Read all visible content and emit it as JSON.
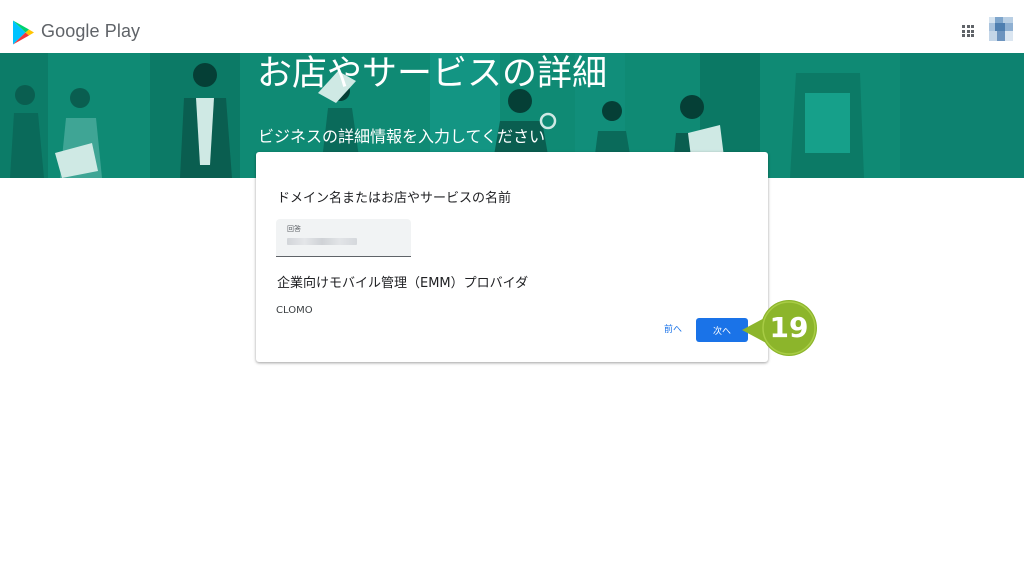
{
  "header": {
    "brand": "Google Play",
    "apps_icon": "apps-grid-icon",
    "avatar": "user-avatar"
  },
  "banner": {
    "title": "お店やサービスの詳細",
    "subtitle": "ビジネスの詳細情報を入力してください",
    "color": "#0f8a74"
  },
  "form": {
    "question1": "ドメイン名またはお店やサービスの名前",
    "answer_label": "回答",
    "question2": "企業向けモバイル管理（EMM）プロバイダ",
    "question2_value": "CLOMO",
    "back_label": "前へ",
    "next_label": "次へ"
  },
  "annotation": {
    "step": "19",
    "color": "#8cb52b"
  },
  "colors": {
    "primary": "#1a73e8",
    "banner": "#0f8a74"
  }
}
